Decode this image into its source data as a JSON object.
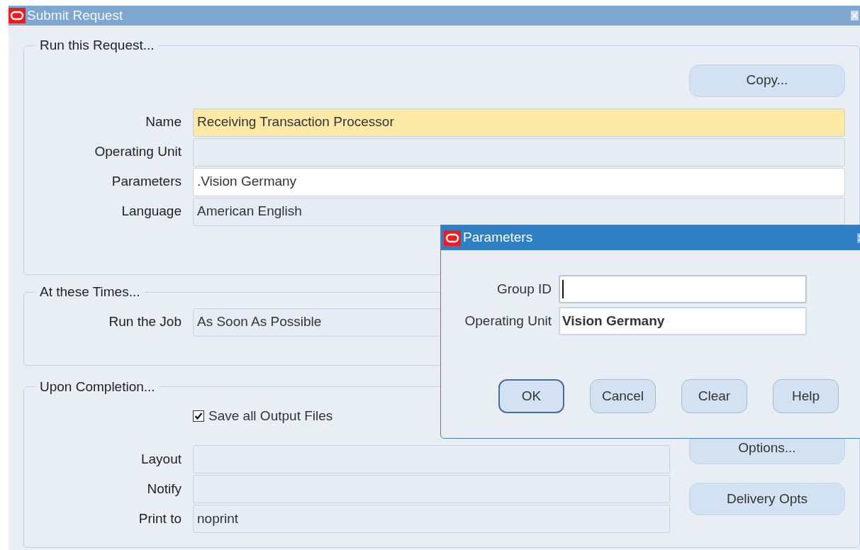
{
  "main_window": {
    "title": "Submit Request",
    "active": false
  },
  "run_request": {
    "legend": "Run this Request...",
    "copy_button": "Copy...",
    "fields": [
      {
        "label": "Name",
        "value": "Receiving Transaction Processor",
        "kind": "required"
      },
      {
        "label": "Operating Unit",
        "kind": "readonly"
      },
      {
        "label": "Parameters",
        "value": ".Vision Germany",
        "kind": "editable"
      },
      {
        "label": "Language",
        "value": "American English",
        "kind": "readonly"
      }
    ]
  },
  "schedule": {
    "legend": "At these Times...",
    "fields": [
      {
        "label": "Run the Job",
        "value": "As Soon As Possible",
        "kind": "readonly"
      }
    ]
  },
  "completion": {
    "legend": "Upon Completion...",
    "save_output": {
      "label": "Save all Output Files",
      "checked": true
    },
    "fields": [
      {
        "label": "Layout",
        "kind": "readonly"
      },
      {
        "label": "Notify",
        "kind": "readonly"
      },
      {
        "label": "Print to",
        "value": "noprint",
        "kind": "readonly"
      }
    ],
    "buttons": [
      "Options...",
      "Delivery Opts"
    ]
  },
  "parameters_dialog": {
    "title": "Parameters",
    "active": true,
    "fields": [
      {
        "label": "Group ID",
        "focused": true
      },
      {
        "label": "Operating Unit",
        "value": "Vision Germany",
        "focused": false
      }
    ],
    "buttons": [
      {
        "label": "OK",
        "default": true
      },
      {
        "label": "Cancel",
        "default": false
      },
      {
        "label": "Clear",
        "default": false
      },
      {
        "label": "Help",
        "default": false
      }
    ]
  }
}
